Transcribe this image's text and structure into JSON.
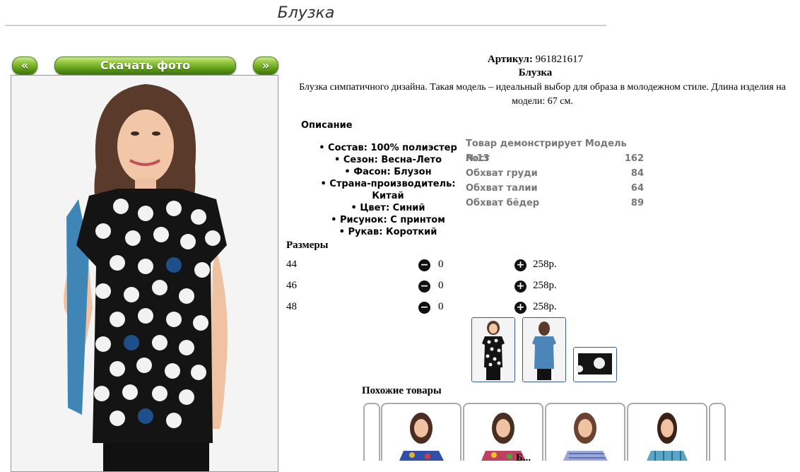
{
  "page": {
    "title": "Блузка"
  },
  "buttons": {
    "prev": "«",
    "download": "Скачать фото",
    "next": "»"
  },
  "product": {
    "article_label": "Артикул:",
    "article_value": "961821617",
    "name": "Блузка",
    "description": "Блузка симпатичного дизайна. Такая модель – идеальный выбор для образа в молодежном стиле. Длина изделия на модели: 67 см."
  },
  "description_section": {
    "heading": "Описание",
    "items": [
      "Состав: 100% полиэстер",
      "Сезон: Весна-Лето",
      "Фасон: Блузон",
      "Страна-производитель: Китай",
      "Цвет: Синий",
      "Рисунок: С принтом",
      "Рукав: Короткий"
    ]
  },
  "model_table": {
    "heading": "Товар демонстрирует Модель №13",
    "rows": [
      {
        "label": "Рост",
        "value": "162"
      },
      {
        "label": "Обхват груди",
        "value": "84"
      },
      {
        "label": "Обхват талии",
        "value": "64"
      },
      {
        "label": "Обхват бёдер",
        "value": "89"
      }
    ]
  },
  "sizes": {
    "heading": "Размеры",
    "rows": [
      {
        "size": "44",
        "qty": "0",
        "price": "258р."
      },
      {
        "size": "46",
        "qty": "0",
        "price": "258р."
      },
      {
        "size": "48",
        "qty": "0",
        "price": "258р."
      }
    ],
    "minus_icon": "−",
    "plus_icon": "+"
  },
  "similar": {
    "heading": "Похожие товары",
    "bottom_text": "Б..."
  },
  "colors": {
    "button_green": "#5e9a17",
    "thumb_border": "#3a5a8a",
    "blouse_dark": "#141414",
    "dot_blue": "#1f4f8a",
    "back_blue": "#4c86b8"
  }
}
